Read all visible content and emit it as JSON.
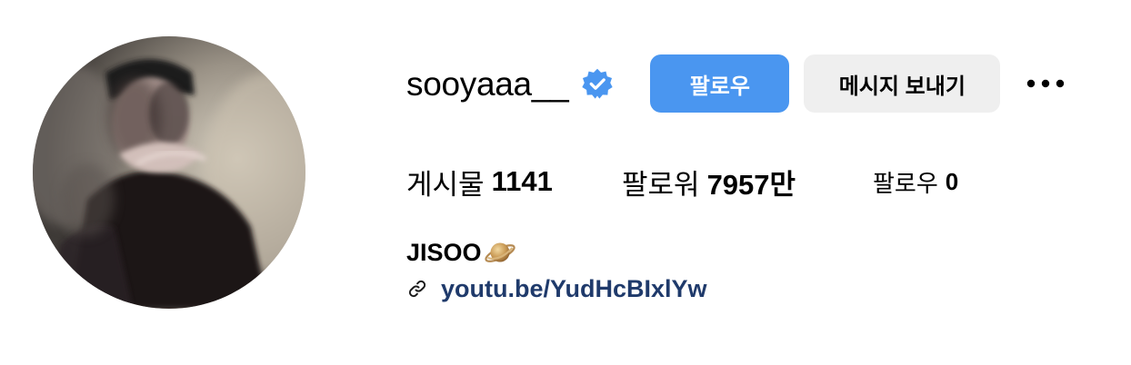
{
  "profile": {
    "username": "sooyaaa__",
    "verified_icon": "verified-badge-icon",
    "actions": {
      "follow_label": "팔로우",
      "message_label": "메시지 보내기",
      "more_icon": "more-options-icon"
    },
    "stats": {
      "posts_label": "게시물",
      "posts_value": "1141",
      "followers_label": "팔로워",
      "followers_value": "7957만",
      "following_label": "팔로우",
      "following_value": "0"
    },
    "bio": {
      "name": "JISOO",
      "name_emoji": "planet-emoji-icon",
      "link_icon": "link-icon",
      "link_text": "youtu.be/YudHcBIxlYw"
    },
    "avatar": "profile-photo"
  },
  "colors": {
    "follow_button": "#4a96f0",
    "message_button": "#efefef",
    "verified_badge": "#4a96f0",
    "link_text": "#1f3a6b"
  }
}
